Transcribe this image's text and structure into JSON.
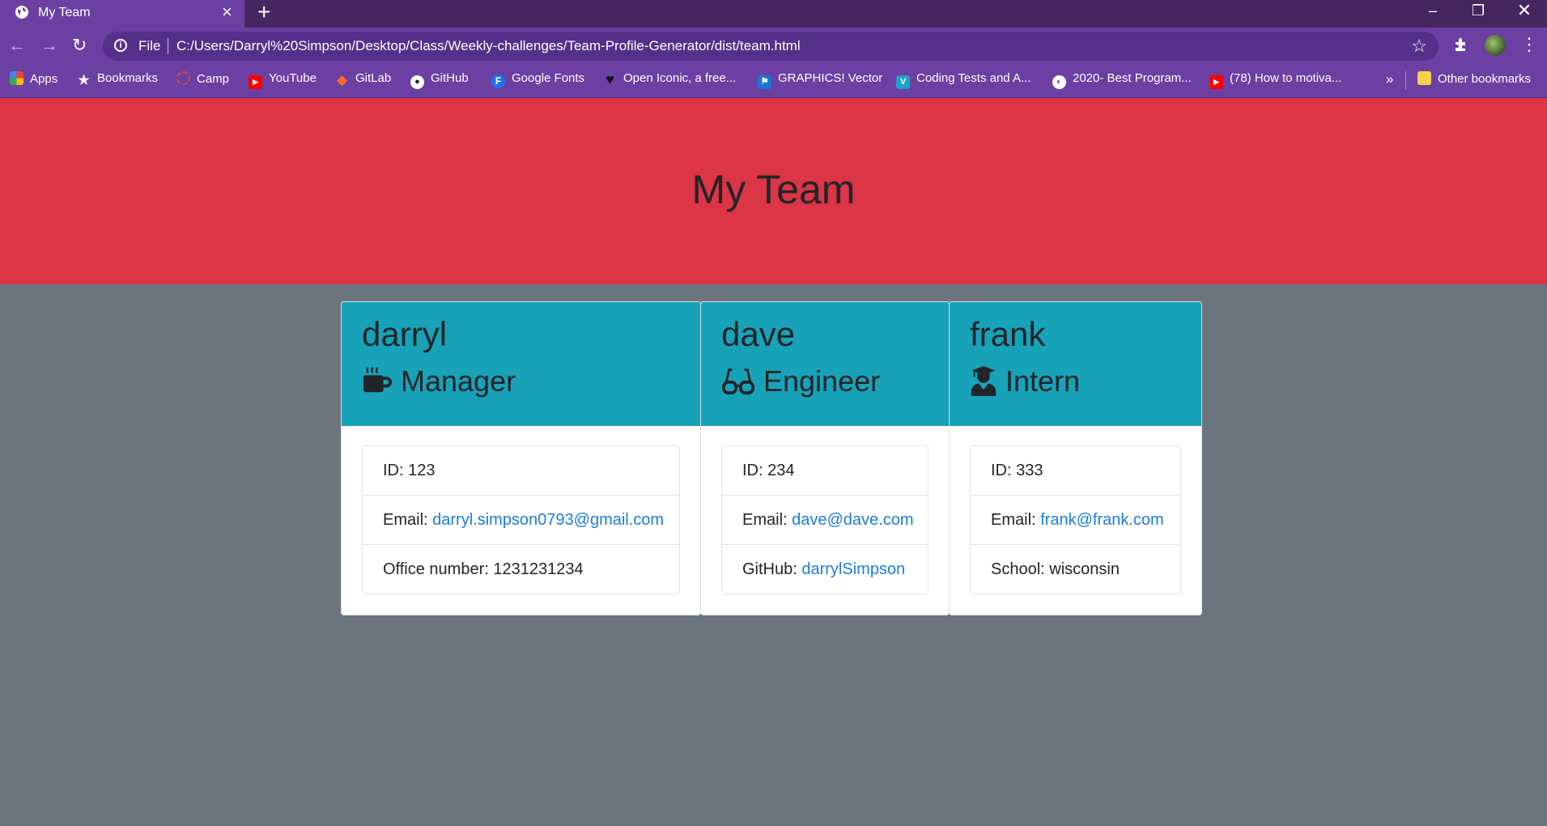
{
  "browser": {
    "tab_title": "My Team",
    "address_scheme": "File",
    "address_url": "C:/Users/Darryl%20Simpson/Desktop/Class/Weekly-challenges/Team-Profile-Generator/dist/team.html",
    "bookmarks": [
      {
        "label": "Apps",
        "icon": "apps-grid-icon"
      },
      {
        "label": "Bookmarks",
        "icon": "star-icon"
      },
      {
        "label": "Camp",
        "icon": "camp-icon"
      },
      {
        "label": "YouTube",
        "icon": "youtube-icon"
      },
      {
        "label": "GitLab",
        "icon": "gitlab-icon"
      },
      {
        "label": "GitHub",
        "icon": "github-icon"
      },
      {
        "label": "Google Fonts",
        "icon": "google-fonts-icon"
      },
      {
        "label": "Open Iconic, a free...",
        "icon": "heart-icon"
      },
      {
        "label": "GRAPHICS! Vector",
        "icon": "flag-icon"
      },
      {
        "label": "Coding Tests and A...",
        "icon": "coding-tests-icon"
      },
      {
        "label": "2020- Best Program...",
        "icon": "globe-icon"
      },
      {
        "label": "(78) How to motiva...",
        "icon": "youtube-icon"
      }
    ],
    "overflow_label": "»",
    "other_bookmarks": "Other bookmarks"
  },
  "page": {
    "title": "My Team",
    "header_color": "#dc3545",
    "card_header_color": "#17a2b8",
    "background_color": "#6c757d",
    "link_color": "#1c7ce6"
  },
  "cards": [
    {
      "name": "darryl",
      "role": "Manager",
      "role_icon": "coffee-mug-icon",
      "id_label": "ID: 123",
      "email_prefix": "Email: ",
      "email": "darryl.simpson0793@gmail.com",
      "extra_prefix": "Office number: ",
      "extra_value": "1231231234"
    },
    {
      "name": "dave",
      "role": "Engineer",
      "role_icon": "glasses-icon",
      "id_label": "ID: 234",
      "email_prefix": "Email: ",
      "email": "dave@dave.com",
      "extra_prefix": "GitHub: ",
      "extra_value": "darrylSimpson"
    },
    {
      "name": "frank",
      "role": "Intern",
      "role_icon": "graduate-icon",
      "id_label": "ID: 333",
      "email_prefix": "Email: ",
      "email": "frank@frank.com",
      "extra_prefix": "School: ",
      "extra_value": "wisconsin"
    }
  ]
}
